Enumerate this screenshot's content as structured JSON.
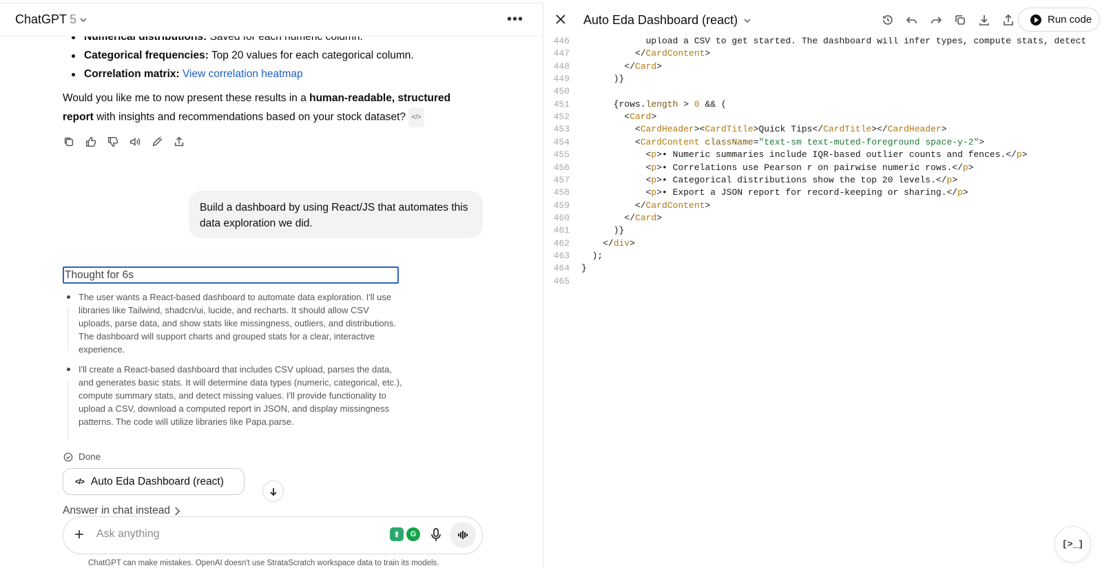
{
  "chat": {
    "model_name": "ChatGPT",
    "model_version": "5",
    "partial_bullet": {
      "label": "Numerical distributions:",
      "text": " Saved for each numeric column."
    },
    "bullets": [
      {
        "label": "Categorical frequencies:",
        "text": " Top 20 values for each categorical column."
      },
      {
        "label": "Correlation matrix:",
        "text": " ",
        "link": "View correlation heatmap"
      }
    ],
    "para": {
      "pre": "Would you like me to now present these results in a ",
      "bold": "human-readable, structured report",
      "post": " with insights and recommendations based on your stock dataset?",
      "chip": "</>"
    },
    "user_message": "Build a dashboard by using React/JS that automates this data exploration we did.",
    "thought_label": "Thought for 6s",
    "reasoning": [
      "The user wants a React-based dashboard to automate data exploration. I'll use libraries like Tailwind, shadcn/ui, lucide, and recharts. It should allow CSV uploads, parse data, and show stats like missingness, outliers, and distributions. The dashboard will support charts and grouped stats for a clear, interactive experience.",
      "I'll create a React-based dashboard that includes CSV upload, parses the data, and generates basic stats. It will determine data types (numeric, categorical, etc.), compute summary stats, and detect missing values. I'll provide functionality to upload a CSV, download a computed report in JSON, and display missingness patterns. The code will utilize libraries like Papa.parse."
    ],
    "done_label": "Done",
    "artifact_label": "Auto Eda Dashboard (react)",
    "answer_in_chat": "Answer in chat instead",
    "composer_placeholder": "Ask anything",
    "disclaimer": "ChatGPT can make mistakes. OpenAI doesn't use StrataScratch workspace data to train its models."
  },
  "canvas": {
    "title": "Auto Eda Dashboard (react)",
    "run_label": "Run code",
    "console_glyph": "[>_]",
    "lines": [
      {
        "n": "446",
        "html": "            upload a CSV to get started. The dashboard will infer types, compute stats, detect"
      },
      {
        "n": "447",
        "html": "          &lt;/<span class=\"tg\">CardContent</span>&gt;"
      },
      {
        "n": "448",
        "html": "        &lt;/<span class=\"tg\">Card</span>&gt;"
      },
      {
        "n": "449",
        "html": "      )}"
      },
      {
        "n": "450",
        "html": ""
      },
      {
        "n": "451",
        "html": "      {rows.<span class=\"at\">length</span> &gt; <span class=\"nm\">0</span> &amp;&amp; ("
      },
      {
        "n": "452",
        "html": "        &lt;<span class=\"tg\">Card</span>&gt;"
      },
      {
        "n": "453",
        "html": "          &lt;<span class=\"tg\">CardHeader</span>&gt;&lt;<span class=\"tg\">CardTitle</span>&gt;Quick Tips&lt;/<span class=\"tg\">CardTitle</span>&gt;&lt;/<span class=\"tg\">CardHeader</span>&gt;"
      },
      {
        "n": "454",
        "html": "          &lt;<span class=\"tg\">CardContent</span> <span class=\"at\">className</span>=<span class=\"st\">\"text-sm text-muted-foreground space-y-2\"</span>&gt;"
      },
      {
        "n": "455",
        "html": "            &lt;<span class=\"tg\">p</span>&gt;• Numeric summaries include IQR-based outlier counts and fences.&lt;/<span class=\"tg\">p</span>&gt;"
      },
      {
        "n": "456",
        "html": "            &lt;<span class=\"tg\">p</span>&gt;• Correlations use Pearson r on pairwise numeric rows.&lt;/<span class=\"tg\">p</span>&gt;"
      },
      {
        "n": "457",
        "html": "            &lt;<span class=\"tg\">p</span>&gt;• Categorical distributions show the top 20 levels.&lt;/<span class=\"tg\">p</span>&gt;"
      },
      {
        "n": "458",
        "html": "            &lt;<span class=\"tg\">p</span>&gt;• Export a JSON report for record-keeping or sharing.&lt;/<span class=\"tg\">p</span>&gt;"
      },
      {
        "n": "459",
        "html": "          &lt;/<span class=\"tg\">CardContent</span>&gt;"
      },
      {
        "n": "460",
        "html": "        &lt;/<span class=\"tg\">Card</span>&gt;"
      },
      {
        "n": "461",
        "html": "      )}"
      },
      {
        "n": "462",
        "html": "    &lt;/<span class=\"tg\">div</span>&gt;"
      },
      {
        "n": "463",
        "html": "  );"
      },
      {
        "n": "464",
        "html": "}"
      },
      {
        "n": "465",
        "html": ""
      }
    ]
  },
  "colors": {
    "link": "#1f5fbf",
    "focus_outline": "#2a63c8",
    "code_tag": "#b07a10",
    "code_string": "#1e7a3a"
  }
}
